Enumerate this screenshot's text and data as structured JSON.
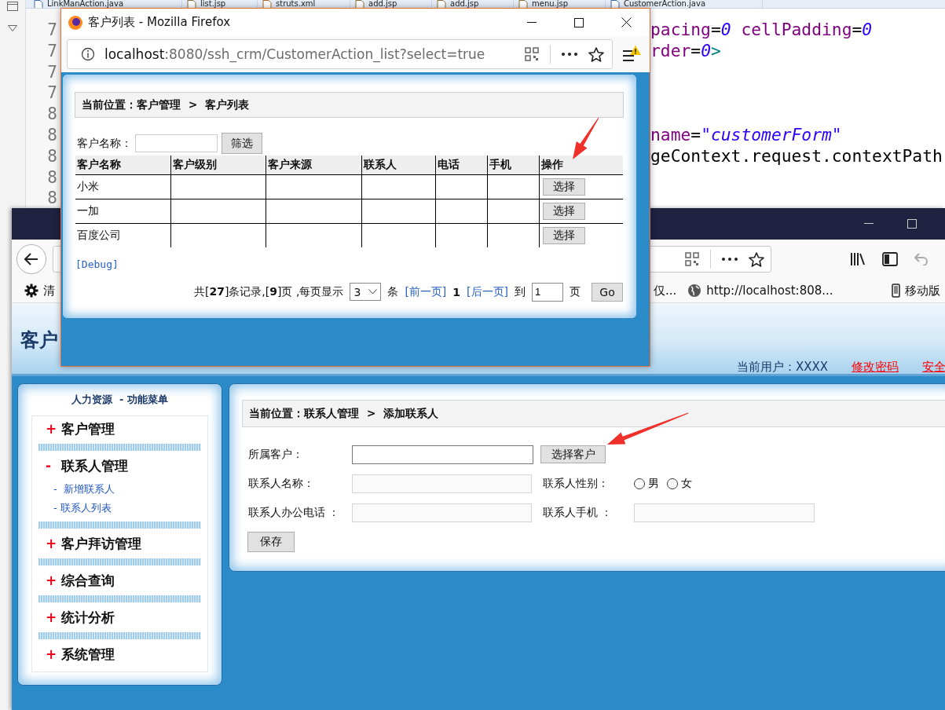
{
  "editor": {
    "tabs": [
      {
        "label": "LinkManAction.java",
        "kind": "java"
      },
      {
        "label": "list.jsp",
        "kind": "jsp"
      },
      {
        "label": "struts.xml",
        "kind": "xml"
      },
      {
        "label": "add.jsp",
        "kind": "jsp"
      },
      {
        "label": "add.jsp",
        "kind": "jsp"
      },
      {
        "label": "menu.jsp",
        "kind": "jsp"
      },
      {
        "label": "CustomerAction.java",
        "kind": "java"
      }
    ],
    "lines": [
      {
        "number": "7",
        "code": [
          {
            "kind": "attr",
            "text": "pacing"
          },
          {
            "kind": "op",
            "text": "="
          },
          {
            "kind": "num",
            "text": "0"
          },
          {
            "kind": "attr",
            "text": " cellPadding"
          },
          {
            "kind": "op",
            "text": "="
          },
          {
            "kind": "num",
            "text": "0"
          }
        ]
      },
      {
        "number": "7",
        "code": [
          {
            "kind": "attr",
            "text": "rder"
          },
          {
            "kind": "op",
            "text": "="
          },
          {
            "kind": "num",
            "text": "0"
          },
          {
            "kind": "punct",
            "text": ">"
          }
        ]
      },
      {
        "number": "7"
      },
      {
        "number": "7"
      },
      {
        "number": "8"
      },
      {
        "number": "8",
        "code": [
          {
            "kind": "attr",
            "text": "name"
          },
          {
            "kind": "op",
            "text": "="
          },
          {
            "kind": "str",
            "text": "\"customerForm\""
          }
        ]
      },
      {
        "number": "8",
        "code": [
          {
            "kind": "plain",
            "text": "geContext.request.contextPath"
          }
        ]
      },
      {
        "number": "8"
      },
      {
        "number": "8"
      }
    ]
  },
  "browser": {
    "bookmarks": [
      {
        "kind": "settings",
        "label": "清"
      },
      {
        "kind": "plain",
        "label": "仅..."
      },
      {
        "kind": "web",
        "label": "http://localhost:808..."
      },
      {
        "kind": "mobile",
        "label": "移动版"
      }
    ],
    "header": {
      "title": "客户",
      "user": "当前用户：XXXX",
      "links": [
        "修改密码",
        "安全"
      ]
    },
    "menu": {
      "title": "人力资源  - 功能菜单",
      "groups": [
        {
          "sign": "+",
          "label": "客户管理"
        },
        {
          "sign": "-",
          "label": "联系人管理",
          "children": [
            {
              "label": "-  新增联系人"
            },
            {
              "label": "- 联系人列表"
            }
          ]
        },
        {
          "sign": "+",
          "label": "客户拜访管理"
        },
        {
          "sign": "+",
          "label": "综合查询"
        },
        {
          "sign": "+",
          "label": "统计分析"
        },
        {
          "sign": "+",
          "label": "系统管理"
        }
      ]
    },
    "form": {
      "breadcrumb": "当前位置：联系人管理  >  添加联系人",
      "customer_label": "所属客户：",
      "select_button": "选择客户",
      "name_label": "联系人名称：",
      "gender_label": "联系人性别：",
      "genders": [
        {
          "label": "男",
          "checked": false
        },
        {
          "label": "女",
          "checked": false
        }
      ],
      "phone_label": "联系人办公电话 ：",
      "mobile_label": "联系人手机 ：",
      "save_button": "保存"
    }
  },
  "popup": {
    "title": "客户列表 - Mozilla Firefox",
    "url_host": "localhost",
    "url_rest": ":8080/ssh_crm/CustomerAction_list?select=true",
    "breadcrumb": "当前位置：客户管理  >  客户列表",
    "filter_label": "客户名称：",
    "filter_button": "筛选",
    "table": {
      "columns": [
        "客户名称",
        "客户级别",
        "客户来源",
        "联系人",
        "电话",
        "手机",
        "操作"
      ],
      "rows": [
        {
          "name": "小米",
          "action": "选择"
        },
        {
          "name": "一加",
          "action": "选择"
        },
        {
          "name": "百度公司",
          "action": "选择"
        }
      ]
    },
    "debug_link": "[Debug]",
    "pager": {
      "summary": "共[**27**]条记录,[**9**]页 ,每页显示",
      "page_size": "3",
      "unit": "条",
      "prev": "[前一页]",
      "current": "1",
      "next": "[后一页]",
      "goto_label": "到",
      "goto_value": "1",
      "page_label": "页",
      "go_button": "Go"
    }
  }
}
